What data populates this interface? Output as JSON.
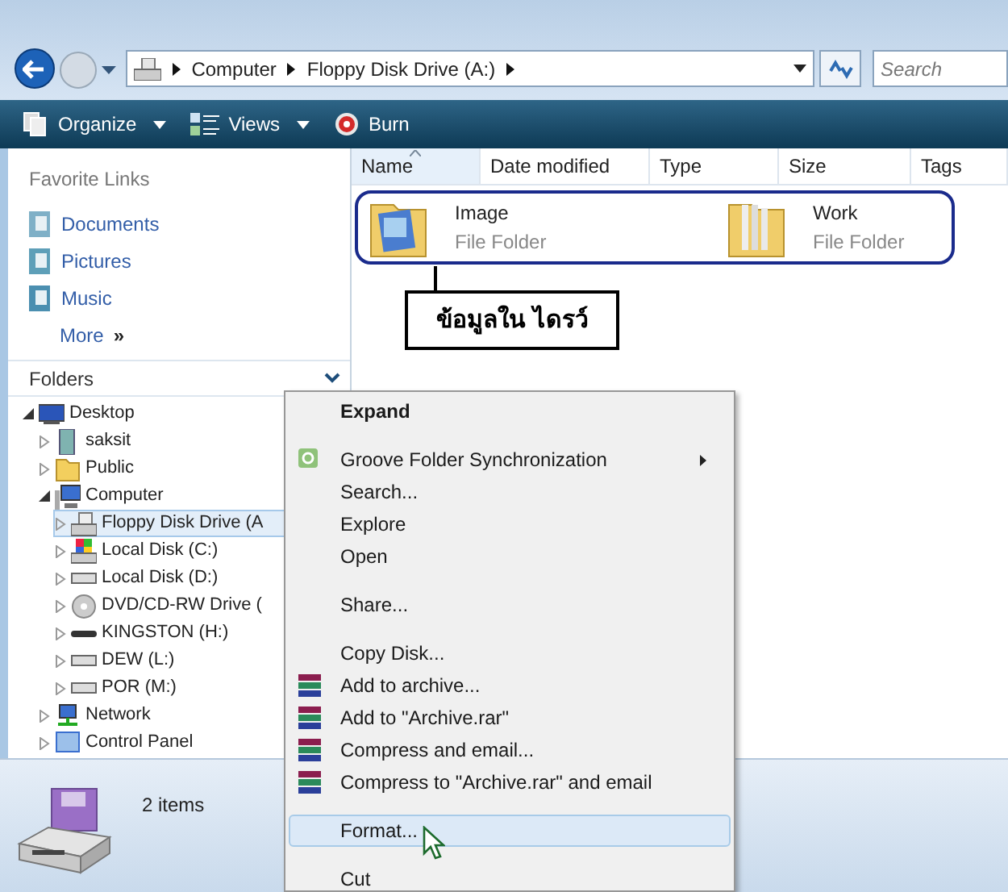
{
  "nav": {
    "breadcrumb": [
      "Computer",
      "Floppy Disk Drive (A:)"
    ],
    "search": {
      "placeholder": "Search"
    }
  },
  "toolbar": [
    {
      "label": "Organize",
      "kind": "menu"
    },
    {
      "label": "Views",
      "kind": "menu"
    },
    {
      "label": "Burn",
      "kind": "button"
    }
  ],
  "favorite_links": {
    "title": "Favorite Links",
    "items": [
      {
        "label": "Documents"
      },
      {
        "label": "Pictures"
      },
      {
        "label": "Music"
      }
    ],
    "more": "More",
    "more_glyph": "»"
  },
  "folders": {
    "title": "Folders",
    "tree": [
      {
        "label": "Desktop",
        "kind": "desktop",
        "expanded": true,
        "selected": false,
        "children": [
          {
            "label": "saksit",
            "kind": "user",
            "expanded": false,
            "selected": false
          },
          {
            "label": "Public",
            "kind": "folder",
            "expanded": false,
            "selected": false
          },
          {
            "label": "Computer",
            "kind": "computer",
            "expanded": true,
            "selected": false,
            "children": [
              {
                "label": "Floppy Disk Drive (A",
                "kind": "floppy",
                "expanded": false,
                "selected": true
              },
              {
                "label": "Local Disk (C:)",
                "kind": "windisk",
                "expanded": false,
                "selected": false
              },
              {
                "label": "Local Disk (D:)",
                "kind": "disk",
                "expanded": false,
                "selected": false
              },
              {
                "label": "DVD/CD-RW Drive (",
                "kind": "dvd",
                "expanded": false,
                "selected": false
              },
              {
                "label": "KINGSTON (H:)",
                "kind": "usb",
                "expanded": false,
                "selected": false
              },
              {
                "label": "DEW (L:)",
                "kind": "disk",
                "expanded": false,
                "selected": false
              },
              {
                "label": "POR (M:)",
                "kind": "disk",
                "expanded": false,
                "selected": false
              }
            ]
          },
          {
            "label": "Network",
            "kind": "network",
            "expanded": false,
            "selected": false
          },
          {
            "label": "Control Panel",
            "kind": "panel",
            "expanded": false,
            "selected": false
          }
        ]
      }
    ]
  },
  "columns": [
    {
      "label": "Name",
      "sorted": true
    },
    {
      "label": "Date modified",
      "sorted": false
    },
    {
      "label": "Type",
      "sorted": false
    },
    {
      "label": "Size",
      "sorted": false
    },
    {
      "label": "Tags",
      "sorted": false
    }
  ],
  "files": [
    {
      "name": "Image",
      "type": "File Folder",
      "kind": "pictures"
    },
    {
      "name": "Work",
      "type": "File Folder",
      "kind": "plain"
    }
  ],
  "annotation": {
    "label": "ข้อมูลใน ไดรว์"
  },
  "status": {
    "text": "2 items"
  },
  "context_menu": [
    {
      "kind": "item",
      "label": "Expand",
      "default": true,
      "selected": false
    },
    {
      "kind": "separator"
    },
    {
      "kind": "sync",
      "label": "Groove Folder Synchronization",
      "submenu": true,
      "default": false,
      "selected": false
    },
    {
      "kind": "item",
      "label": "Search...",
      "default": false,
      "selected": false
    },
    {
      "kind": "item",
      "label": "Explore",
      "default": false,
      "selected": false
    },
    {
      "kind": "item",
      "label": "Open",
      "default": false,
      "selected": false
    },
    {
      "kind": "separator"
    },
    {
      "kind": "item",
      "label": "Share...",
      "default": false,
      "selected": false
    },
    {
      "kind": "separator"
    },
    {
      "kind": "item",
      "label": "Copy Disk...",
      "default": false,
      "selected": false
    },
    {
      "kind": "archive",
      "label": "Add to archive...",
      "default": false,
      "selected": false
    },
    {
      "kind": "archive",
      "label": "Add to \"Archive.rar\"",
      "default": false,
      "selected": false
    },
    {
      "kind": "archive",
      "label": "Compress and email...",
      "default": false,
      "selected": false
    },
    {
      "kind": "archive",
      "label": "Compress to \"Archive.rar\" and email",
      "default": false,
      "selected": false
    },
    {
      "kind": "separator"
    },
    {
      "kind": "item",
      "label": "Format...",
      "default": false,
      "selected": true
    },
    {
      "kind": "separator"
    },
    {
      "kind": "item",
      "label": "Cut",
      "default": false,
      "selected": false
    }
  ]
}
